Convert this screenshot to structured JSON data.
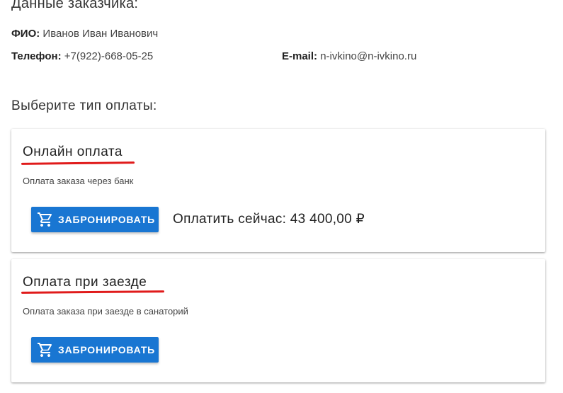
{
  "customer": {
    "heading": "Данные заказчика:",
    "fio_label": "ФИО:",
    "fio_value": "Иванов Иван Иванович",
    "phone_label": "Телефон:",
    "phone_value": "+7(922)-668-05-25",
    "email_label": "E-mail:",
    "email_value": "n-ivkino@n-ivkino.ru"
  },
  "payment": {
    "heading": "Выберите тип оплаты:",
    "online": {
      "title": "Онлайн оплата",
      "description": "Оплата заказа через банк",
      "button_label": "ЗАБРОНИРОВАТЬ",
      "button_icon": "cart-icon",
      "pay_now_text": "Оплатить сейчас: 43 400,00 ₽"
    },
    "arrival": {
      "title": "Оплата при заезде",
      "description": "Оплата заказа при заезде в санаторий",
      "button_label": "ЗАБРОНИРОВАТЬ",
      "button_icon": "cart-icon"
    }
  },
  "colors": {
    "button_bg": "#1976d2",
    "underline": "#e01b1b"
  }
}
